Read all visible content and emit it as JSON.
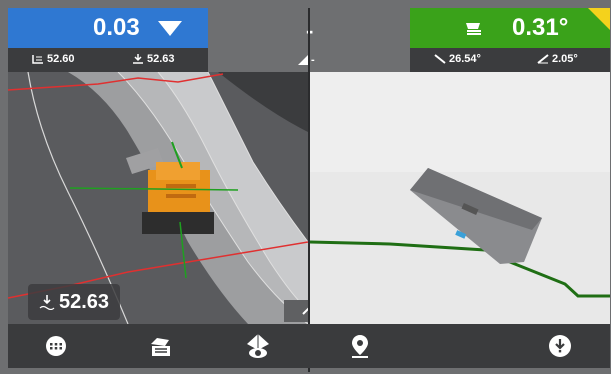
{
  "elevation": {
    "value": "0.03",
    "left_reading": "52.60",
    "right_reading": "52.63"
  },
  "center": {
    "top_value": "-",
    "sub_value": "-"
  },
  "slope": {
    "value": "0.31°",
    "cross_slope": "26.54°",
    "main_slope": "2.05°"
  },
  "overlay": {
    "elevation": "52.63"
  },
  "colors": {
    "elevation_box": "#2f78d2",
    "slope_box": "#3aa21a",
    "warning_corner": "#f4d21c",
    "design_line": "#e03030",
    "profile_line": "#1f6e14"
  },
  "icons": {
    "bottom": [
      "keypad-icon",
      "machine-view-icon",
      "view-mode-icon",
      "location-pin-icon",
      "alert-icon"
    ],
    "header": [
      "down-arrow-icon",
      "bucket-icon",
      "left-edge-icon",
      "right-edge-icon",
      "slope-icon",
      "cross-slope-icon",
      "main-slope-icon",
      "chevron-up-icon"
    ]
  }
}
